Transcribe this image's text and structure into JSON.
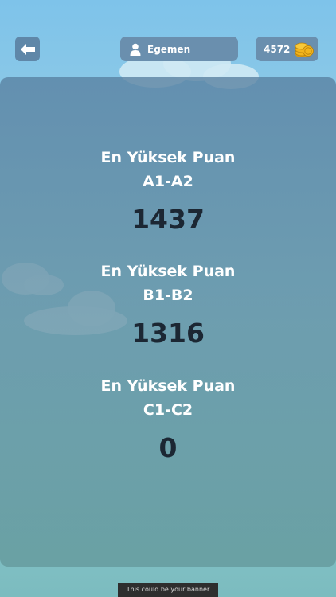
{
  "header": {
    "username": "Egemen",
    "coins": "4572"
  },
  "icons": {
    "back": "arrow-left-icon",
    "user": "user-icon",
    "coins": "coin-stack-icon"
  },
  "scores": [
    {
      "title": "En Yüksek Puan",
      "level": "A1-A2",
      "value": "1437"
    },
    {
      "title": "En Yüksek Puan",
      "level": "B1-B2",
      "value": "1316"
    },
    {
      "title": "En Yüksek Puan",
      "level": "C1-C2",
      "value": "0"
    }
  ],
  "footer": {
    "banner_text": "This could be your banner"
  },
  "colors": {
    "sky_top": "#7ec3ea",
    "sky_bottom": "#7cbcbf",
    "pill": "#6a8fae",
    "score_value": "#1c2733",
    "coin": "#f2b51d"
  }
}
